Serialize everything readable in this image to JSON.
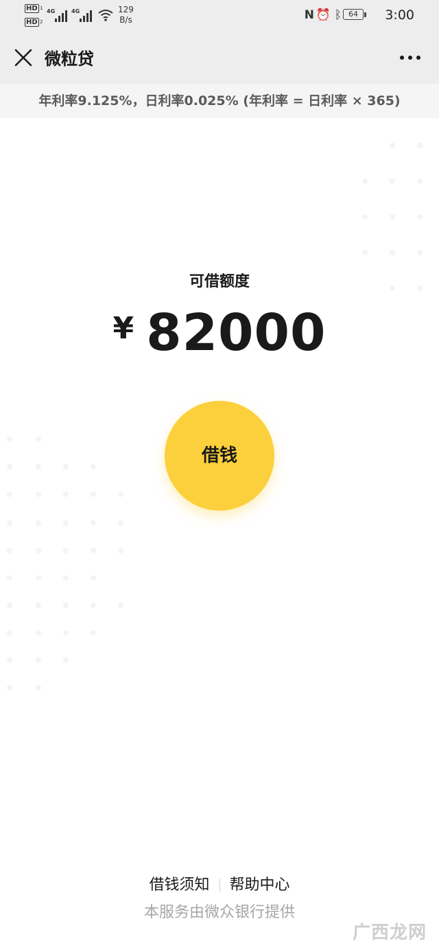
{
  "status_bar": {
    "hd_label": "HD",
    "sim1": "1",
    "sim2": "2",
    "network1": "4G",
    "network2": "4G",
    "speed_value": "129",
    "speed_unit": "B/s",
    "nfc_label": "N",
    "battery_level": "64",
    "time": "3:00"
  },
  "nav": {
    "title": "微粒贷"
  },
  "rate_banner": {
    "text": "年利率9.125%，日利率0.025% (年利率 = 日利率 × 365)"
  },
  "quota": {
    "label": "可借额度",
    "currency": "¥",
    "amount": "82000"
  },
  "borrow_button": {
    "label": "借钱"
  },
  "footer": {
    "links": [
      "借钱须知",
      "帮助中心"
    ],
    "provider": "本服务由微众银行提供"
  },
  "watermark": {
    "text": "广西龙网"
  },
  "colors": {
    "accent": "#fcd03c",
    "header_bg": "#ededed",
    "banner_bg": "#f5f5f5",
    "muted_text": "#a6a6a6"
  }
}
